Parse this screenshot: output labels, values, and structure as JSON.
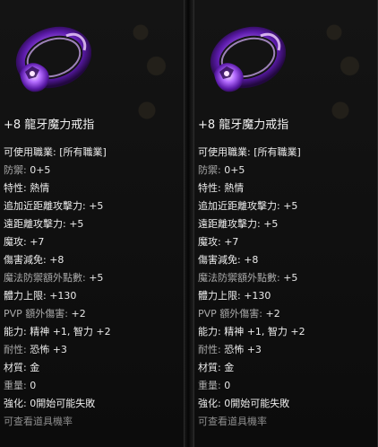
{
  "item": {
    "name": "+8 龍牙魔力戒指",
    "icon": "purple-dragon-ring-icon",
    "accent_color": "#7a2bd6",
    "stats": [
      {
        "label": "可使用職業:",
        "value": "[所有職業]",
        "tone": "white"
      },
      {
        "label": "防禦:",
        "value": "0+5",
        "tone": "normal"
      },
      {
        "label": "特性:",
        "value": "熱情",
        "tone": "white"
      },
      {
        "label": "追加近距離攻擊力:",
        "value": "+5",
        "tone": "white"
      },
      {
        "label": "遠距離攻擊力:",
        "value": "+5",
        "tone": "white"
      },
      {
        "label": "魔攻:",
        "value": "+7",
        "tone": "white"
      },
      {
        "label": "傷害減免:",
        "value": "+8",
        "tone": "white"
      },
      {
        "label": "魔法防禦額外點數:",
        "value": "+5",
        "tone": "normal"
      },
      {
        "label": "體力上限:",
        "value": "+130",
        "tone": "white"
      },
      {
        "label": "PVP 額外傷害:",
        "value": "+2",
        "tone": "normal"
      },
      {
        "label": "能力:",
        "value": "精神 +1, 智力 +2",
        "tone": "white"
      },
      {
        "label": "耐性:",
        "value": "恐怖 +3",
        "tone": "normal"
      },
      {
        "label": "材質:",
        "value": "金",
        "tone": "white"
      },
      {
        "label": "重量:",
        "value": "0",
        "tone": "normal"
      },
      {
        "label": "強化:",
        "value": "0開始可能失敗",
        "tone": "white"
      },
      {
        "label": "可查看道具機率",
        "value": "",
        "tone": "dim"
      }
    ]
  }
}
